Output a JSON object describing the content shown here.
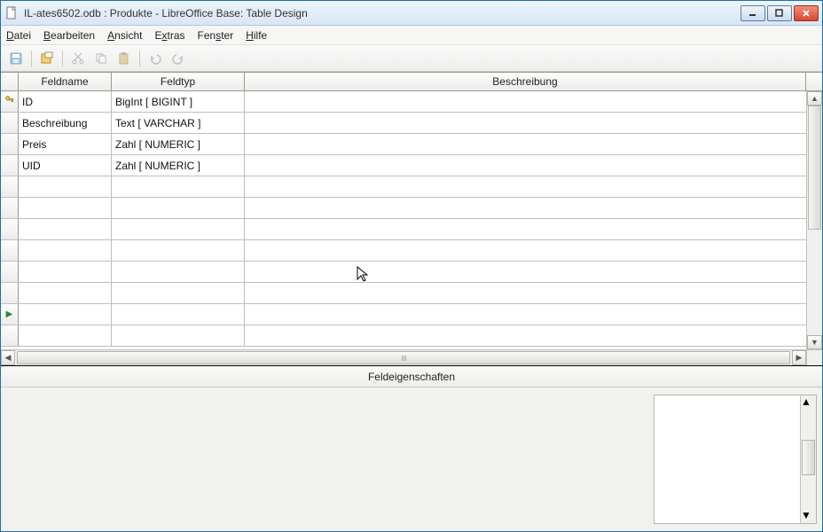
{
  "title": "IL-ates6502.odb : Produkte - LibreOffice Base: Table Design",
  "menu": {
    "datei": "Datei",
    "bearbeiten": "Bearbeiten",
    "ansicht": "Ansicht",
    "extras": "Extras",
    "fenster": "Fenster",
    "hilfe": "Hilfe"
  },
  "columns": {
    "fieldname": "Feldname",
    "fieldtype": "Feldtyp",
    "description": "Beschreibung"
  },
  "rows": [
    {
      "key": true,
      "name": "ID",
      "type": "BigInt [ BIGINT ]",
      "desc": ""
    },
    {
      "key": false,
      "name": "Beschreibung",
      "type": "Text [ VARCHAR ]",
      "desc": ""
    },
    {
      "key": false,
      "name": "Preis",
      "type": "Zahl [ NUMERIC ]",
      "desc": ""
    },
    {
      "key": false,
      "name": "UID",
      "type": "Zahl [ NUMERIC ]",
      "desc": ""
    }
  ],
  "props_title": "Feldeigenschaften",
  "toolbar_icons": [
    "save",
    "index",
    "cut",
    "copy",
    "paste",
    "undo",
    "redo"
  ]
}
